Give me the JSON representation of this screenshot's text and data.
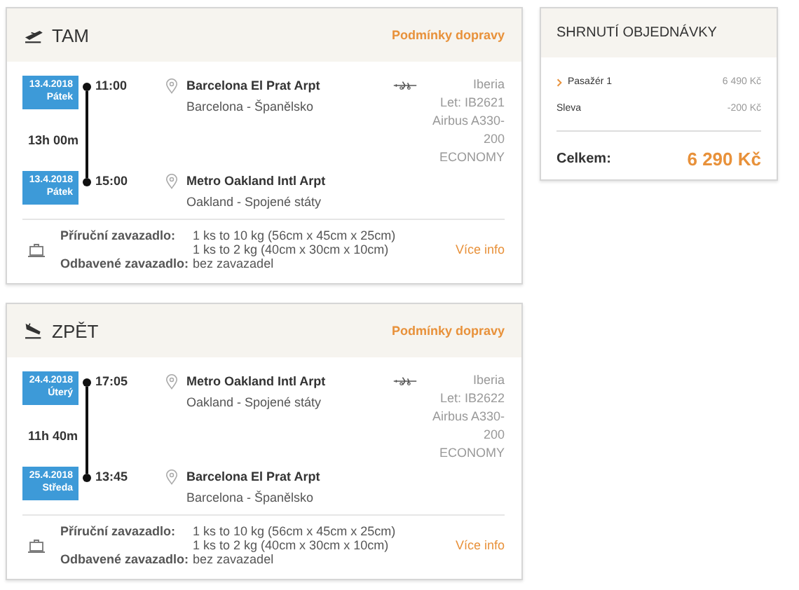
{
  "flights": [
    {
      "kind": "departure",
      "title": "TAM",
      "conditions_link": "Podmínky dopravy",
      "stops": [
        {
          "date": "13.4.2018",
          "day": "Pátek",
          "time": "11:00",
          "airport": "Barcelona El Prat Arpt",
          "city": "Barcelona - Španělsko"
        },
        {
          "date": "13.4.2018",
          "day": "Pátek",
          "time": "15:00",
          "airport": "Metro Oakland Intl Arpt",
          "city": "Oakland - Spojené státy"
        }
      ],
      "duration": "13h 00m",
      "carrier": [
        "Iberia",
        "Let: IB2621",
        "Airbus A330-",
        "200",
        "ECONOMY"
      ],
      "baggage": {
        "cabin_label": "Příruční zavazadlo:",
        "cabin": [
          "1 ks to 10 kg (56cm x 45cm x 25cm)",
          "1 ks to 2 kg (40cm x 30cm x 10cm)"
        ],
        "checked_label": "Odbavené zavazadlo:",
        "checked": "bez zavazadel",
        "more_link": "Více info"
      }
    },
    {
      "kind": "arrival",
      "title": "ZPĚT",
      "conditions_link": "Podmínky dopravy",
      "stops": [
        {
          "date": "24.4.2018",
          "day": "Úterý",
          "time": "17:05",
          "airport": "Metro Oakland Intl Arpt",
          "city": "Oakland - Spojené státy"
        },
        {
          "date": "25.4.2018",
          "day": "Středa",
          "time": "13:45",
          "airport": "Barcelona El Prat Arpt",
          "city": "Barcelona - Španělsko"
        }
      ],
      "duration": "11h 40m",
      "carrier": [
        "Iberia",
        "Let: IB2622",
        "Airbus A330-",
        "200",
        "ECONOMY"
      ],
      "baggage": {
        "cabin_label": "Příruční zavazadlo:",
        "cabin": [
          "1 ks to 10 kg (56cm x 45cm x 25cm)",
          "1 ks to 2 kg (40cm x 30cm x 10cm)"
        ],
        "checked_label": "Odbavené zavazadlo:",
        "checked": "bez zavazadel",
        "more_link": "Více info"
      }
    }
  ],
  "summary": {
    "title": "SHRNUTÍ OBJEDNÁVKY",
    "items": [
      {
        "kind": "expandable",
        "label": "Pasažér 1",
        "amount": "6 490 Kč",
        "expanded": false
      },
      {
        "kind": "plain",
        "label": "Sleva",
        "amount": "-200 Kč"
      }
    ],
    "total_label": "Celkem:",
    "total": "6 290 Kč"
  }
}
